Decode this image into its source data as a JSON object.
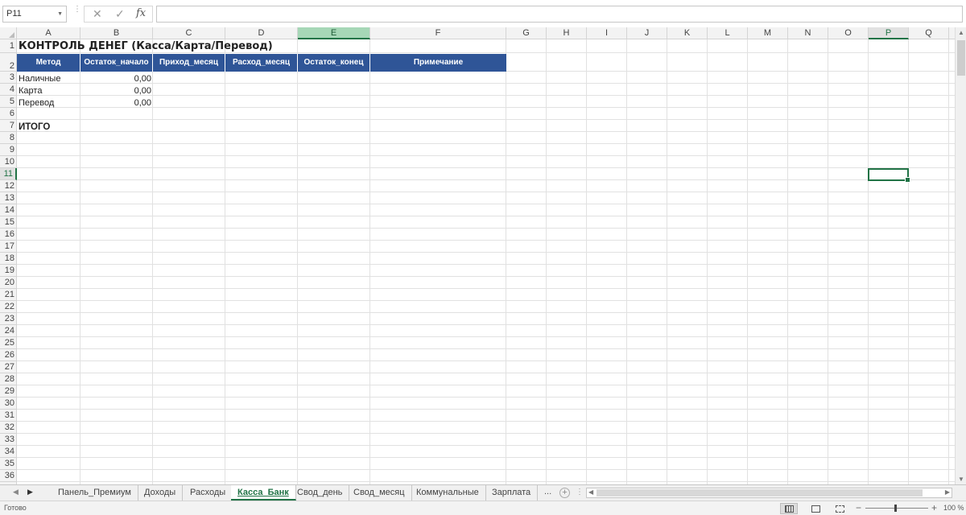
{
  "formula_bar": {
    "name_box": "P11",
    "cancel_icon": "✕",
    "enter_icon": "✓",
    "fx_label": "fx",
    "formula": ""
  },
  "columns": [
    "A",
    "B",
    "C",
    "D",
    "E",
    "F",
    "G",
    "H",
    "I",
    "J",
    "K",
    "L",
    "M",
    "N",
    "O",
    "P",
    "Q"
  ],
  "active_column": "E",
  "selected_column": "P",
  "rows": [
    "1",
    "2",
    "3",
    "4",
    "5",
    "6",
    "7",
    "8",
    "9",
    "10",
    "11",
    "12",
    "13",
    "14",
    "15",
    "16",
    "17",
    "18",
    "19",
    "20",
    "21",
    "22",
    "23",
    "24",
    "25",
    "26",
    "27",
    "28",
    "29",
    "30",
    "31",
    "32",
    "33",
    "34",
    "35",
    "36"
  ],
  "selected_row": "11",
  "sheet": {
    "title": "КОНТРОЛЬ ДЕНЕГ (Касса/Карта/Перевод)",
    "headers": [
      "Метод",
      "Остаток_начало",
      "Приход_месяц",
      "Расход_месяц",
      "Остаток_конец",
      "Примечание"
    ],
    "data_rows": [
      {
        "method": "Наличные",
        "start": "0,00"
      },
      {
        "method": "Карта",
        "start": "0,00"
      },
      {
        "method": "Перевод",
        "start": "0,00"
      }
    ],
    "total_label": "ИТОГО"
  },
  "tabs": {
    "items": [
      "Панель_Премиум",
      "Доходы",
      "Расходы",
      "Касса_Банк",
      "Свод_день",
      "Свод_месяц",
      "Коммунальные",
      "Зарплата"
    ],
    "active": "Касса_Банк",
    "more": "...",
    "add": "+"
  },
  "status": {
    "ready": "Готово",
    "zoom": "100 %",
    "zoom_percent": 100
  },
  "colors": {
    "header_fill": "#2f5597",
    "accent": "#217346",
    "active_col_fill": "#a6d7b7"
  }
}
